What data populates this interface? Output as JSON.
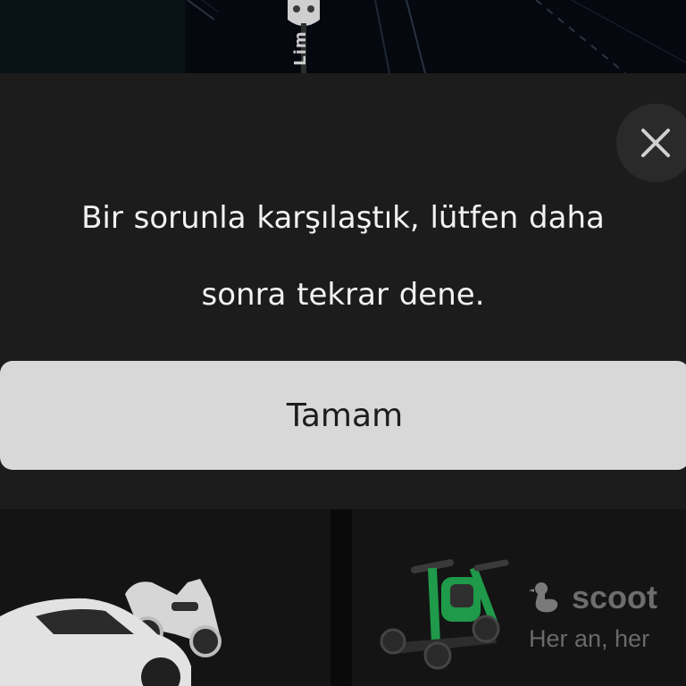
{
  "map": {
    "vehicle_label": "Lim"
  },
  "dialog": {
    "message_line1": "Bir sorunla karşılaştık, lütfen daha",
    "message_line2": "sonra tekrar dene.",
    "confirm_label": "Tamam",
    "close_icon": "close-icon"
  },
  "cards": {
    "car_scooter_icon": "car-and-scooter-illustration",
    "kick_scooter_icon": "kick-scooter-illustration",
    "brand_name": "scoot",
    "brand_icon": "duck-logo-icon",
    "brand_tagline": "Her an, her"
  },
  "colors": {
    "dialog_background": "#1c1c1c",
    "button_background": "#d8d8d8",
    "scooter_green": "#1f9a4a"
  }
}
